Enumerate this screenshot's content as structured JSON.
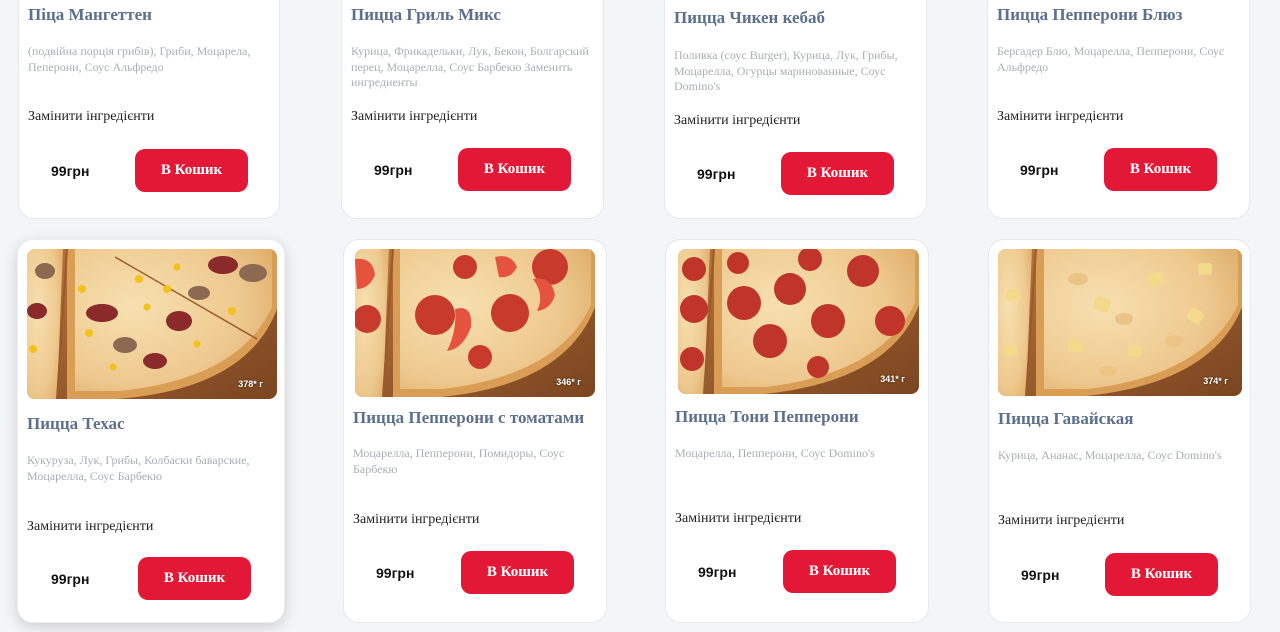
{
  "colors": {
    "accent": "#e31837",
    "title": "#5c6f8d",
    "description": "#a9aeb5"
  },
  "pizzas": [
    {
      "name": "Піца Мангеттен",
      "description": "(подвійна порція грибів), Гриби, Моцарела, Пеперони, Соус Альфредо",
      "replace": "Замінити інгредієнти",
      "price": "99грн",
      "button": "В Кошик"
    },
    {
      "name": "Пицца Гриль Микс",
      "description": "Курица, Фрикадельки, Лук, Бекон, Болгарский перец, Моцарелла, Соус Барбекю Заменить ингредиенты",
      "replace": "Замінити інгредієнти",
      "price": "99грн",
      "button": "В Кошик"
    },
    {
      "name": "Пицца Чикен кебаб",
      "description": "Поливка (соус Burger), Курица, Лук, Грибы, Моцарелла, Огурцы маринованные, Соус Domino's",
      "replace": "Замінити інгредієнти",
      "price": "99грн",
      "button": "В Кошик"
    },
    {
      "name": "Пицца Пепперони Блюз",
      "description": "Бергадер Блю, Моцарелла, Пепперони, Соус Альфредо",
      "replace": "Замінити інгредієнти",
      "price": "99грн",
      "button": "В Кошик"
    },
    {
      "name": "Пицца Техас",
      "description": "Кукуруза, Лук, Грибы, Колбаски баварские, Моцарелла, Соус Барбекю",
      "replace": "Замінити інгредієнти",
      "price": "99грн",
      "button": "В Кошик",
      "weight": "378* г"
    },
    {
      "name": "Пицца Пепперони с томатами",
      "description": "Моцарелла, Пепперони, Помидоры, Соус Барбекю",
      "replace": "Замінити інгредієнти",
      "price": "99грн",
      "button": "В Кошик",
      "weight": "346* г"
    },
    {
      "name": "Пицца Тони Пепперони",
      "description": "Моцарелла, Пепперони, Соус Domino's",
      "replace": "Замінити інгредієнти",
      "price": "99грн",
      "button": "В Кошик",
      "weight": "341* г"
    },
    {
      "name": "Пицца Гавайская",
      "description": "Курица, Ананас, Моцарелла, Соус Domino's",
      "replace": "Замінити інгредієнти",
      "price": "99грн",
      "button": "В Кошик",
      "weight": "374* г"
    }
  ]
}
